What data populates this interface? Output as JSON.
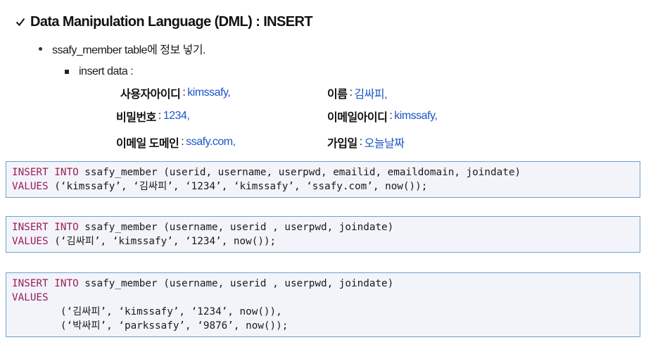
{
  "heading": {
    "text": "Data Manipulation Language (DML) : INSERT"
  },
  "bullet1": {
    "text": "ssafy_member table에 정보 넣기."
  },
  "bullet2": {
    "text": "insert data :"
  },
  "fields": {
    "userid": {
      "label": "사용자아이디",
      "value": "kimssafy,"
    },
    "username": {
      "label": "이름",
      "value": "김싸피,"
    },
    "userpwd": {
      "label": "비밀번호",
      "value": "1234,"
    },
    "emailid": {
      "label": "이메일아이디",
      "value": "kimssafy,"
    },
    "emaildomain": {
      "label": "이메일 도메인",
      "value": "ssafy.com,"
    },
    "joindate": {
      "label": "가입일",
      "value": "오늘날짜"
    }
  },
  "code": {
    "block1": {
      "kw1": "INSERT INTO",
      "rest1": " ssafy_member (userid, username, userpwd, emailid, emaildomain, joindate)",
      "kw2": "VALUES",
      "rest2": " (‘kimssafy’, ‘김싸피’, ‘1234’, ‘kimssafy’, ‘ssafy.com’, now());"
    },
    "block2": {
      "kw1": "INSERT INTO",
      "rest1": " ssafy_member (username, userid , userpwd, joindate)",
      "kw2": "VALUES",
      "rest2": " (‘김싸피’, ‘kimssafy’, ‘1234’, now());"
    },
    "block3": {
      "kw1": "INSERT INTO",
      "rest1": " ssafy_member (username, userid , userpwd, joindate)",
      "kw2": "VALUES",
      "row1": "        (‘김싸피’, ‘kimssafy’, ‘1234’, now()),",
      "row2": "        (‘박싸피’, ‘parkssafy’, ‘9876’, now());"
    }
  },
  "colors": {
    "keyword": "#9c1c5a",
    "value_text": "#1a55c8",
    "code_border": "#6ea0cf",
    "code_bg": "#f2f4fa"
  },
  "icons": {
    "heading_bullet": "checkmark-icon",
    "level1_bullet": "dot",
    "level2_bullet": "square"
  }
}
